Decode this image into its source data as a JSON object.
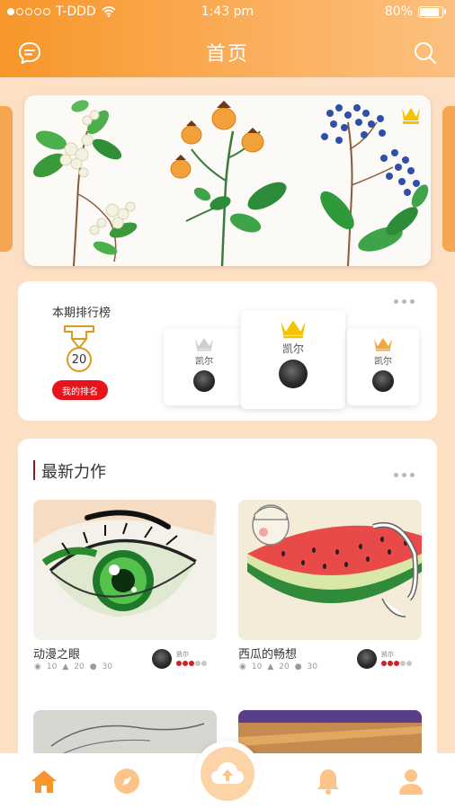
{
  "status_bar": {
    "carrier": "T-DDD",
    "time": "1:43 pm",
    "battery": "80%"
  },
  "header": {
    "title": "首页",
    "left_icon": "chat-bubble-icon",
    "right_icon": "search-icon"
  },
  "ranking": {
    "title": "本期排行榜",
    "my_rank": "20",
    "my_rank_button": "我的排名",
    "podium": [
      {
        "place": "second",
        "name": "凯尔",
        "crown_color": "#cfcfcf"
      },
      {
        "place": "first",
        "name": "凯尔",
        "crown_color": "#f5c400"
      },
      {
        "place": "third",
        "name": "凯尔",
        "crown_color": "#f0a840"
      }
    ]
  },
  "latest": {
    "title": "最新力作",
    "works": [
      {
        "title": "动漫之眼",
        "author": "凯尔",
        "views": "10",
        "likes": "20",
        "comments": "30",
        "rating": 3
      },
      {
        "title": "西瓜的畅想",
        "author": "凯尔",
        "views": "10",
        "likes": "20",
        "comments": "30",
        "rating": 3
      }
    ]
  },
  "tabbar": {
    "items": [
      "home-icon",
      "compass-icon",
      "upload-cloud-icon",
      "bell-icon",
      "user-icon"
    ],
    "active": "home-icon",
    "accent": "#f7962a",
    "inactive": "#fcc489"
  }
}
